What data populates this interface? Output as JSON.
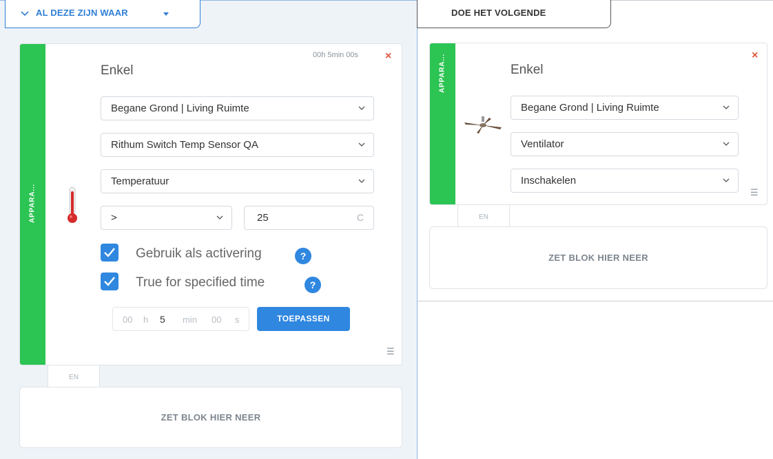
{
  "conditions": {
    "tab_label": "AL DEZE ZIJN WAAR",
    "card": {
      "strip_label": "APPARA...",
      "timer": "00h 5min 00s",
      "close": "×",
      "title": "Enkel",
      "room_select": "Begane Grond | Living Ruimte",
      "device_select": "Rithum Switch Temp Sensor QA",
      "property_select": "Temperatuur",
      "operator_select": ">",
      "value": "25",
      "unit": "C",
      "checkbox_activation_label": "Gebruik als activering",
      "checkbox_activation_checked": true,
      "checkbox_time_label": "True for specified time",
      "checkbox_time_checked": true,
      "help_glyph": "?",
      "time": {
        "hours": "00",
        "hours_unit": "h",
        "minutes": "5",
        "minutes_unit": "min",
        "seconds": "00",
        "seconds_unit": "s"
      },
      "apply_label": "TOEPASSEN",
      "menu_glyph": "☰",
      "icon": "thermometer-icon"
    },
    "connector": "EN",
    "drop_label": "ZET BLOK HIER NEER"
  },
  "actions": {
    "tab_label": "DOE HET VOLGENDE",
    "card": {
      "strip_label": "APPARA...",
      "close": "×",
      "title": "Enkel",
      "room_select": "Begane Grond | Living Ruimte",
      "device_select": "Ventilator",
      "action_select": "Inschakelen",
      "menu_glyph": "☰",
      "icon": "ceiling-fan-icon"
    },
    "connector": "EN",
    "drop_label": "ZET BLOK HIER NEER"
  },
  "colors": {
    "accent_blue": "#2f87e0",
    "strip_green": "#2cc453",
    "close_red": "#e0573f"
  }
}
